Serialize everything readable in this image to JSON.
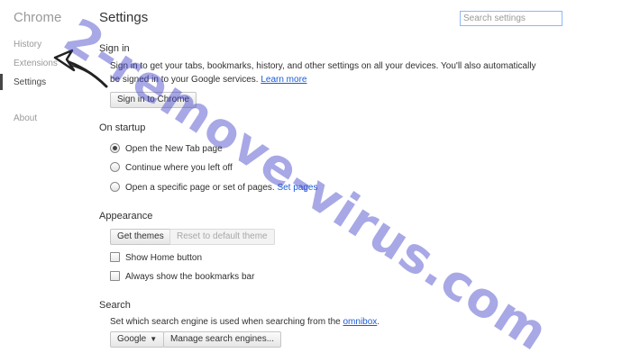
{
  "sidebar": {
    "brand": "Chrome",
    "items": [
      {
        "label": "History"
      },
      {
        "label": "Extensions"
      },
      {
        "label": "Settings"
      },
      {
        "label": "About"
      }
    ]
  },
  "header": {
    "title": "Settings",
    "search_placeholder": "Search settings"
  },
  "sign_in": {
    "heading": "Sign in",
    "line1": "Sign in to get your tabs, bookmarks, history, and other settings on all your devices. You'll also automatically",
    "line2": "be signed in to your Google services.",
    "learn_more": "Learn more",
    "button": "Sign in to Chrome"
  },
  "on_startup": {
    "heading": "On startup",
    "options": [
      {
        "label": "Open the New Tab page",
        "checked": true
      },
      {
        "label": "Continue where you left off",
        "checked": false
      },
      {
        "label": "Open a specific page or set of pages.",
        "checked": false,
        "link": "Set pages"
      }
    ]
  },
  "appearance": {
    "heading": "Appearance",
    "get_themes": "Get themes",
    "reset_theme": "Reset to default theme",
    "show_home": "Show Home button",
    "show_bookmarks": "Always show the bookmarks bar"
  },
  "search": {
    "heading": "Search",
    "description": "Set which search engine is used when searching from the",
    "omnibox_link": "omnibox",
    "period": ".",
    "engine": "Google",
    "manage": "Manage search engines..."
  },
  "watermark": {
    "text": "2-remove-virus.com",
    "color": "#3f3fc8"
  }
}
